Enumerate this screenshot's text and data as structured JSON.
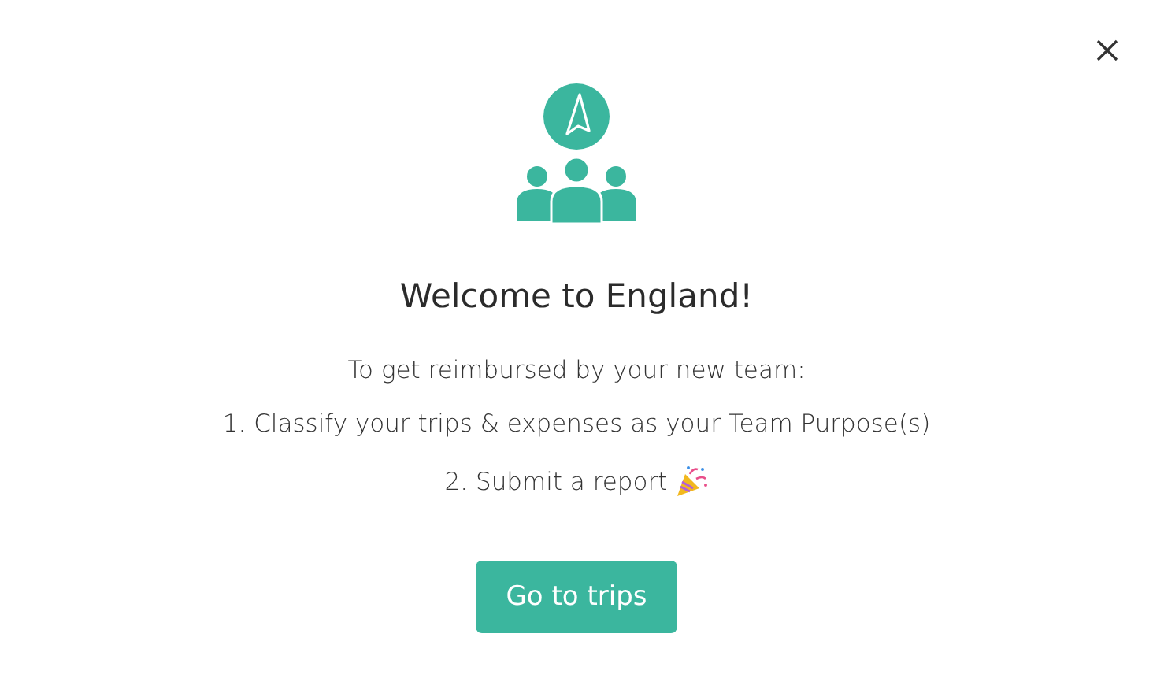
{
  "title": "Welcome to England!",
  "intro": "To get reimbursed by your new team:",
  "steps": [
    {
      "text": "1. Classify your trips & expenses as your Team Purpose(s)",
      "kind": "plain"
    },
    {
      "text": "2. Submit a report",
      "kind": "celebrate"
    }
  ],
  "button": "Go to trips"
}
